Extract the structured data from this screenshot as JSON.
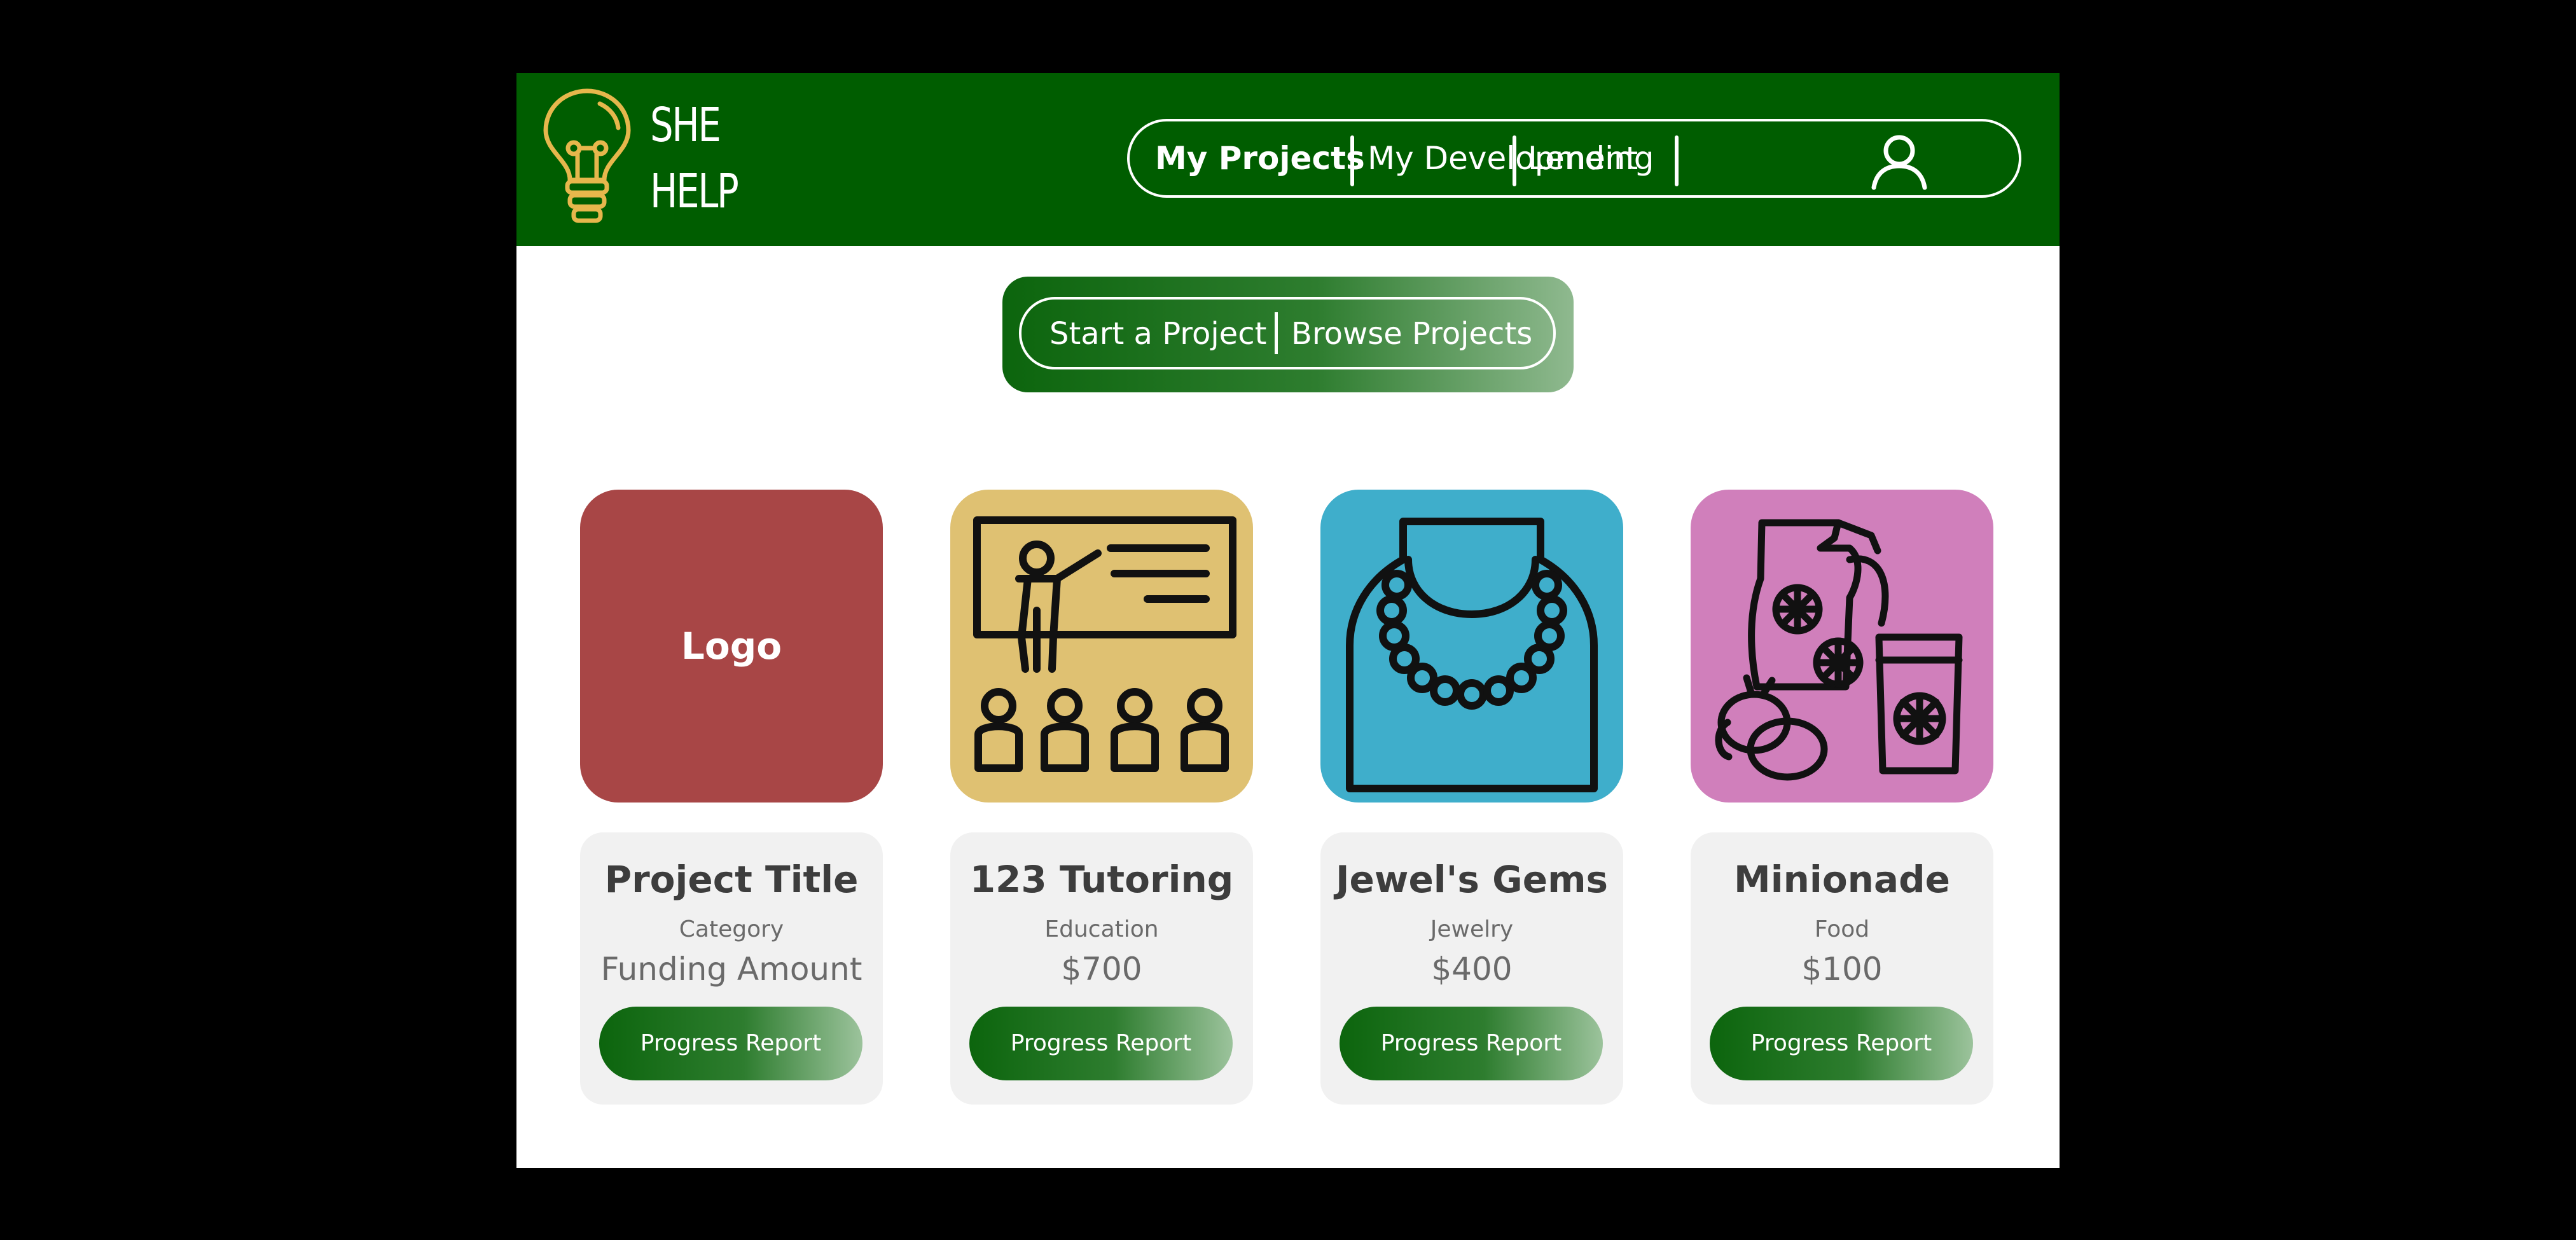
{
  "header": {
    "brand_line1": "SHE",
    "brand_line2": "HELP",
    "nav": [
      {
        "label": "My Projects",
        "active": true
      },
      {
        "label": "My Development",
        "active": false
      },
      {
        "label": "Lending",
        "active": false
      }
    ],
    "icons": {
      "logo": "lightbulb-icon",
      "profile": "user-icon"
    }
  },
  "toggle": {
    "left_label": "Start a Project",
    "right_label": "Browse Projects"
  },
  "projects": [
    {
      "image_text": "Logo",
      "icon": "placeholder-logo",
      "tile_color": "#a84646",
      "title": "Project Title",
      "category": "Category",
      "amount": "Funding Amount",
      "button": "Progress Report"
    },
    {
      "icon": "teacher-classroom-icon",
      "tile_color": "#dfc172",
      "title": "123 Tutoring",
      "category": "Education",
      "amount": "$700",
      "button": "Progress Report"
    },
    {
      "icon": "necklace-icon",
      "tile_color": "#3faecb",
      "title": "Jewel's Gems",
      "category": "Jewelry",
      "amount": "$400",
      "button": "Progress Report"
    },
    {
      "icon": "lemonade-pitcher-icon",
      "tile_color": "#d07fbb",
      "title": "Minionade",
      "category": "Food",
      "amount": "$100",
      "button": "Progress Report"
    }
  ],
  "colors": {
    "header_green": "#005d00",
    "button_green": "#0c650d",
    "page_background": "#000000",
    "card_background": "#f1f1f1",
    "bulb_yellow": "#e6b74c"
  }
}
